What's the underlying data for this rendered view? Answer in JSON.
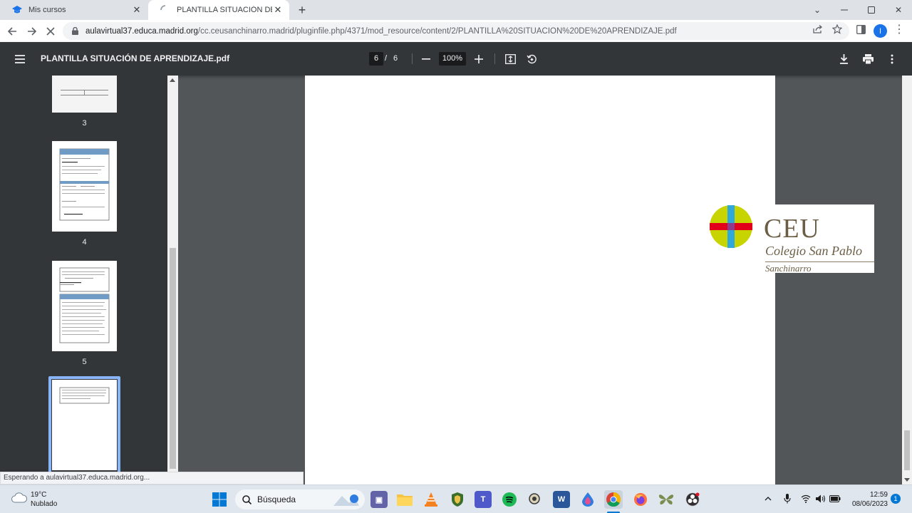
{
  "browser": {
    "tabs": [
      {
        "title": "Mis cursos",
        "active": false
      },
      {
        "title": "PLANTILLA SITUACIÓN DE APRE",
        "active": true
      }
    ],
    "url_prefix": "aulavirtual37.educa.madrid.org",
    "url_rest": "/cc.ceusanchinarro.madrid/pluginfile.php/4371/mod_resource/content/2/PLANTILLA%20SITUACIÓN%20DE%20APRENDIZAJE.pdf",
    "profile_initial": "I",
    "status_text": "Esperando a aulavirtual37.educa.madrid.org..."
  },
  "pdf": {
    "title": "PLANTILLA SITUACIÓN DE APRENDIZAJE.pdf",
    "current_page": "6",
    "separator": "/",
    "total_pages": "6",
    "zoom": "100%"
  },
  "thumbnails": [
    {
      "label": "3"
    },
    {
      "label": "4"
    },
    {
      "label": "5"
    },
    {
      "label": ""
    }
  ],
  "logo": {
    "name": "CEU",
    "subtitle": "Colegio San Pablo",
    "campus": "Sanchinarro",
    "colors": {
      "yellow": "#c8d400",
      "red": "#e3001b",
      "blue": "#2fa9dc",
      "text": "#6b5e45"
    }
  },
  "taskbar": {
    "temperature": "19°C",
    "condition": "Nublado",
    "search_label": "Búsqueda",
    "time": "12:59",
    "date": "08/06/2023",
    "notification_count": "1"
  }
}
